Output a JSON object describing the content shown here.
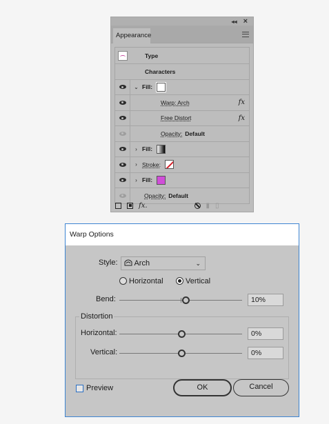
{
  "appearance_panel": {
    "collapse_glyph": "◂◂",
    "close_glyph": "×",
    "tab_label": "Appearance",
    "rows": {
      "type": "Type",
      "characters": "Characters",
      "fill1": "Fill:",
      "warp": "Warp: Arch",
      "free_distort": "Free Distort",
      "opacity_inner_label": "Opacity:",
      "opacity_inner_value": "Default",
      "fill2": "Fill:",
      "stroke": "Stroke:",
      "fill3": "Fill:",
      "opacity_label": "Opacity:",
      "opacity_value": "Default"
    },
    "expand_open": "⌄",
    "expand_closed": "›",
    "fx_glyph": "fx",
    "fx_menu_glyph": "fx.",
    "swatch_colors": {
      "stroke": "#d4202a",
      "fill3": "#d04ed8"
    }
  },
  "warp_dialog": {
    "title": "Warp Options",
    "style_label": "Style:",
    "style_value": "Arch",
    "style_icon": "arch-icon",
    "orientation": {
      "horizontal": "Horizontal",
      "vertical": "Vertical",
      "selected": "Vertical"
    },
    "bend": {
      "label": "Bend:",
      "value": "10%",
      "level": 10
    },
    "distortion": {
      "group_label": "Distortion",
      "horizontal": {
        "label": "Horizontal:",
        "value": "0%",
        "level": 0
      },
      "vertical": {
        "label": "Vertical:",
        "value": "0%",
        "level": 0
      }
    },
    "preview_label": "Preview",
    "preview_checked": false,
    "ok_label": "OK",
    "cancel_label": "Cancel",
    "accent_color": "#3c84d2"
  }
}
